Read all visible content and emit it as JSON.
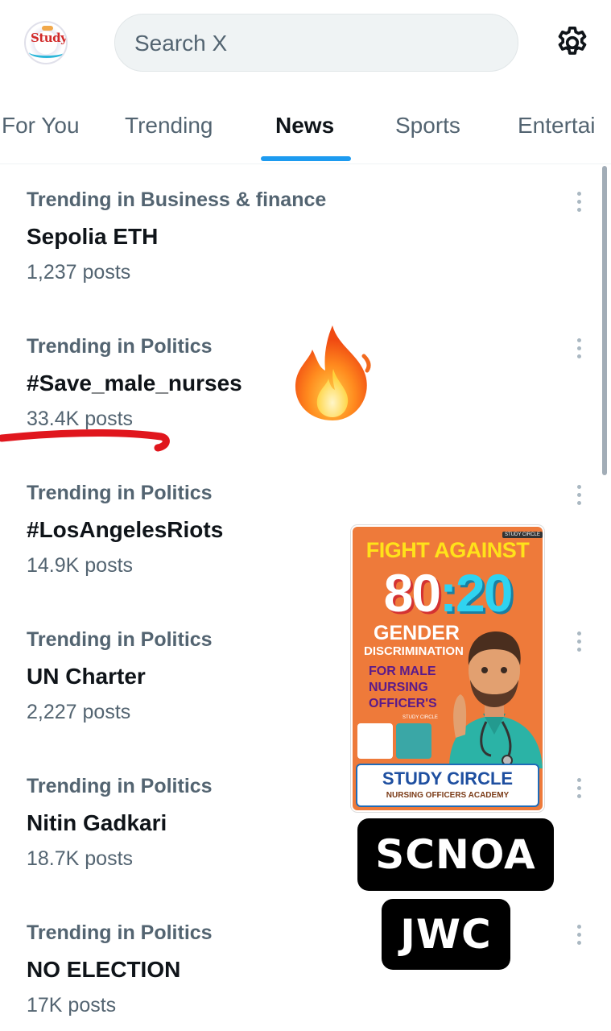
{
  "header": {
    "avatar_text": "Study",
    "search_placeholder": "Search X",
    "settings_icon": "gear-icon"
  },
  "tabs": [
    {
      "label": "For You",
      "active": false
    },
    {
      "label": "Trending",
      "active": false
    },
    {
      "label": "News",
      "active": true
    },
    {
      "label": "Sports",
      "active": false
    },
    {
      "label": "Entertai",
      "active": false
    }
  ],
  "trends": [
    {
      "category": "Trending in Business & finance",
      "name": "Sepolia ETH",
      "count": "1,237 posts"
    },
    {
      "category": "Trending in Politics",
      "name": "#Save_male_nurses",
      "count": "33.4K posts"
    },
    {
      "category": "Trending in Politics",
      "name": "#LosAngelesRiots",
      "count": "14.9K posts"
    },
    {
      "category": "Trending in Politics",
      "name": "UN Charter",
      "count": "2,227 posts"
    },
    {
      "category": "Trending in Politics",
      "name": "Nitin Gadkari",
      "count": "18.7K posts"
    },
    {
      "category": "Trending in Politics",
      "name": "NO ELECTION",
      "count": "17K posts"
    }
  ],
  "poster": {
    "tag": "STUDY CIRCLE",
    "line1": "FIGHT AGAINST",
    "ratio_a": "80",
    "ratio_sep": ":",
    "ratio_b": "20",
    "gender": "GENDER",
    "discrimination": "DISCRIMINATION",
    "for_line1": "FOR MALE",
    "for_line2": "NURSING",
    "for_line3": "OFFICER'S",
    "study_small": "STUDY CIRCLE",
    "band_title": "STUDY CIRCLE",
    "band_sub": "NURSING OFFICERS ACADEMY"
  },
  "labels": {
    "scnoa": "SCNOA",
    "jwc": "JWC"
  },
  "colors": {
    "accent": "#1d9bf0",
    "secondary_text": "#536471",
    "primary_text": "#0f1419",
    "annotation_red": "#e0161d",
    "poster_bg": "#ee7a3a"
  }
}
